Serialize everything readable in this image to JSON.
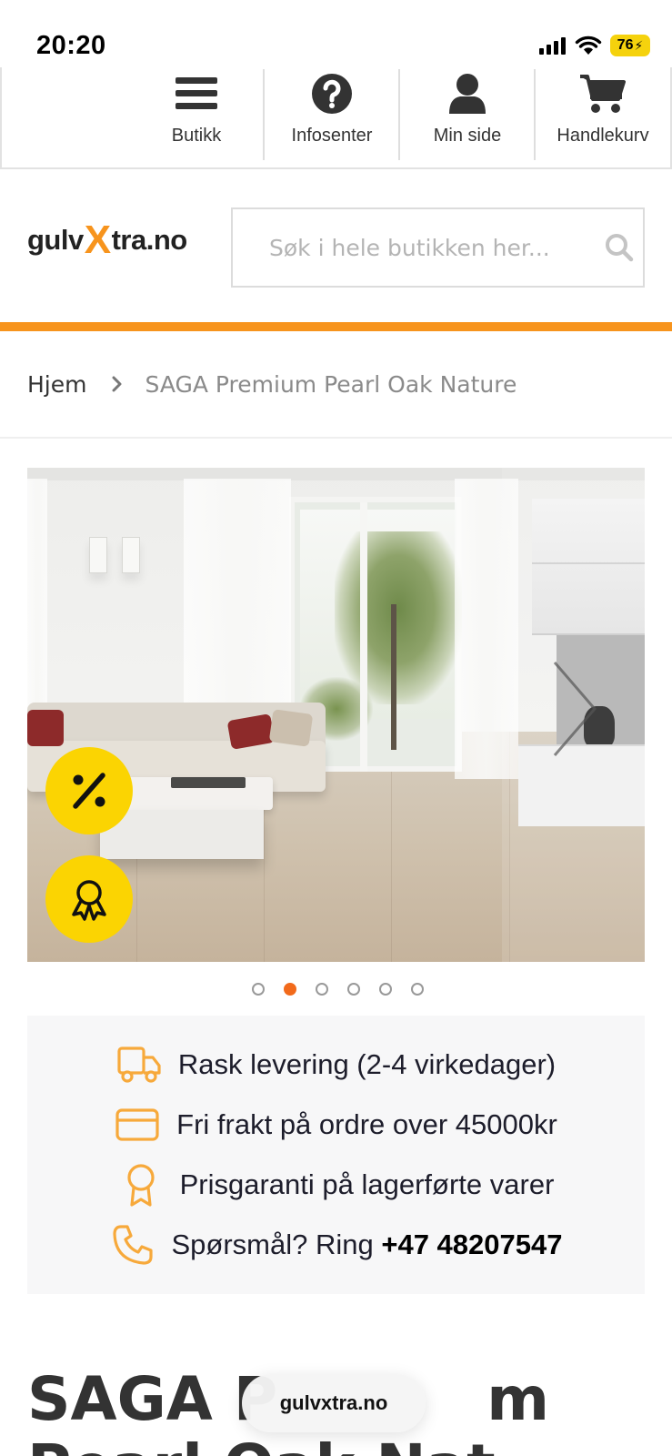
{
  "status_bar": {
    "time": "20:20",
    "battery": "76"
  },
  "topnav": {
    "items": [
      {
        "label": "Butikk",
        "icon": "menu-icon"
      },
      {
        "label": "Infosenter",
        "icon": "question-icon"
      },
      {
        "label": "Min side",
        "icon": "user-icon"
      },
      {
        "label": "Handlekurv",
        "icon": "cart-icon"
      }
    ]
  },
  "header": {
    "logo": {
      "part1": "gulv",
      "part2": "X",
      "part3": "tra.no"
    },
    "search": {
      "placeholder": "Søk i hele butikken her..."
    }
  },
  "breadcrumb": {
    "home": "Hjem",
    "current": "SAGA Premium Pearl Oak Nature"
  },
  "gallery": {
    "slide_count": 6,
    "active_slide": 2,
    "badges": [
      "discount-badge-icon",
      "award-badge-icon"
    ]
  },
  "usp": {
    "items": [
      {
        "icon": "truck-icon",
        "text": "Rask levering (2-4 virkedager)"
      },
      {
        "icon": "card-icon",
        "text": "Fri frakt på ordre over 45000kr"
      },
      {
        "icon": "award-icon",
        "text": "Prisgaranti på lagerførte varer"
      },
      {
        "icon": "phone-icon",
        "text": "Spørsmål? Ring ",
        "phone": "+47 48207547"
      }
    ]
  },
  "product": {
    "title_line1": "SAGA P",
    "title_line1_end": "m",
    "title_line2": "Pearl Oak Nat"
  },
  "browser": {
    "url": "gulvxtra.no"
  },
  "colors": {
    "accent": "#f7941d",
    "badge": "#fbd402",
    "active_dot": "#f26a1b"
  }
}
